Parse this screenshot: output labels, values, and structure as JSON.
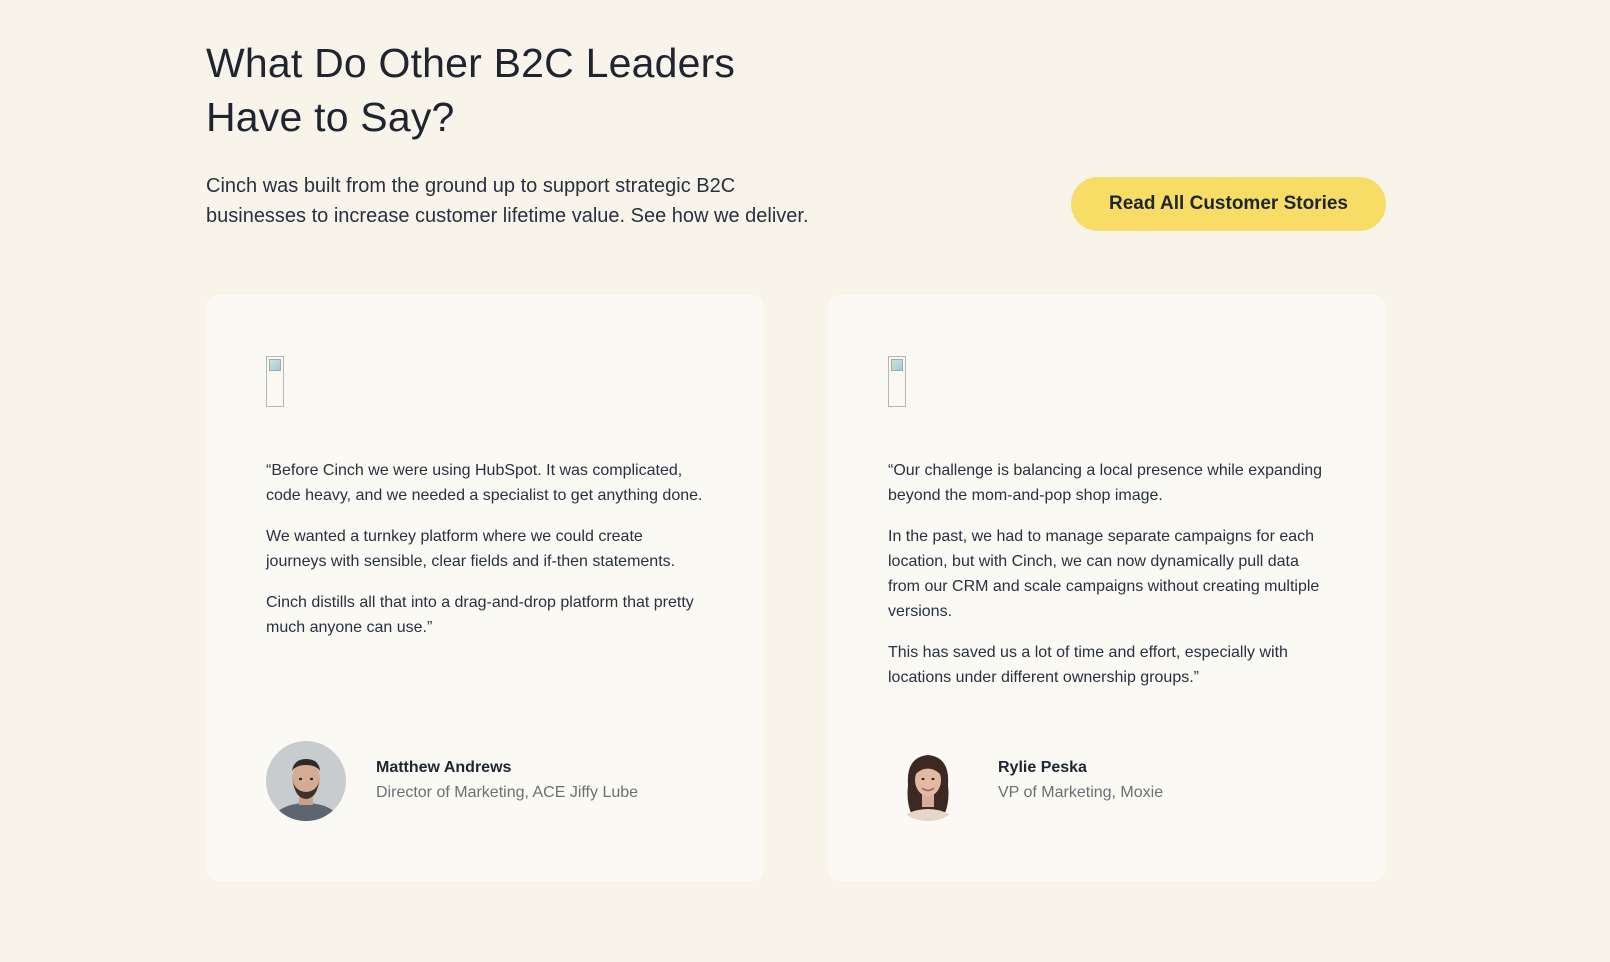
{
  "header": {
    "title_line1": "What Do Other B2C Leaders",
    "title_line2": "Have to Say?",
    "intro_line1": "Cinch was built from the ground up to support strategic B2C",
    "intro_line2": "businesses to increase customer lifetime value. See how we deliver.",
    "cta_label": "Read All Customer Stories"
  },
  "testimonials": [
    {
      "paragraphs": [
        "“Before Cinch we were using HubSpot. It was complicated, code heavy, and we needed a specialist to get anything done.",
        "We wanted a turnkey platform where we could create journeys with sensible, clear fields and if-then statements.",
        "Cinch distills all that into a drag-and-drop platform that pretty much anyone can use.”"
      ],
      "author_name": "Matthew Andrews",
      "author_title": "Director of Marketing, ACE Jiffy Lube"
    },
    {
      "paragraphs": [
        "“Our challenge is balancing a local presence while expanding beyond the mom-and-pop shop image.",
        "In the past, we had to manage separate campaigns for each location, but with Cinch, we can now dynamically pull data from our CRM and scale campaigns without creating multiple versions.",
        "This has saved us a lot of time and effort, especially with locations under different ownership groups.”"
      ],
      "author_name": "Rylie Peska",
      "author_title": "VP of Marketing, Moxie"
    }
  ],
  "colors": {
    "page_background": "#f8f4ea",
    "card_background": "#fbf9f4",
    "button_background": "#f7dc66",
    "heading_text": "#1e2531",
    "muted_text": "#6b6f77"
  },
  "icons": {
    "logo_placeholder": "broken-image-icon"
  }
}
